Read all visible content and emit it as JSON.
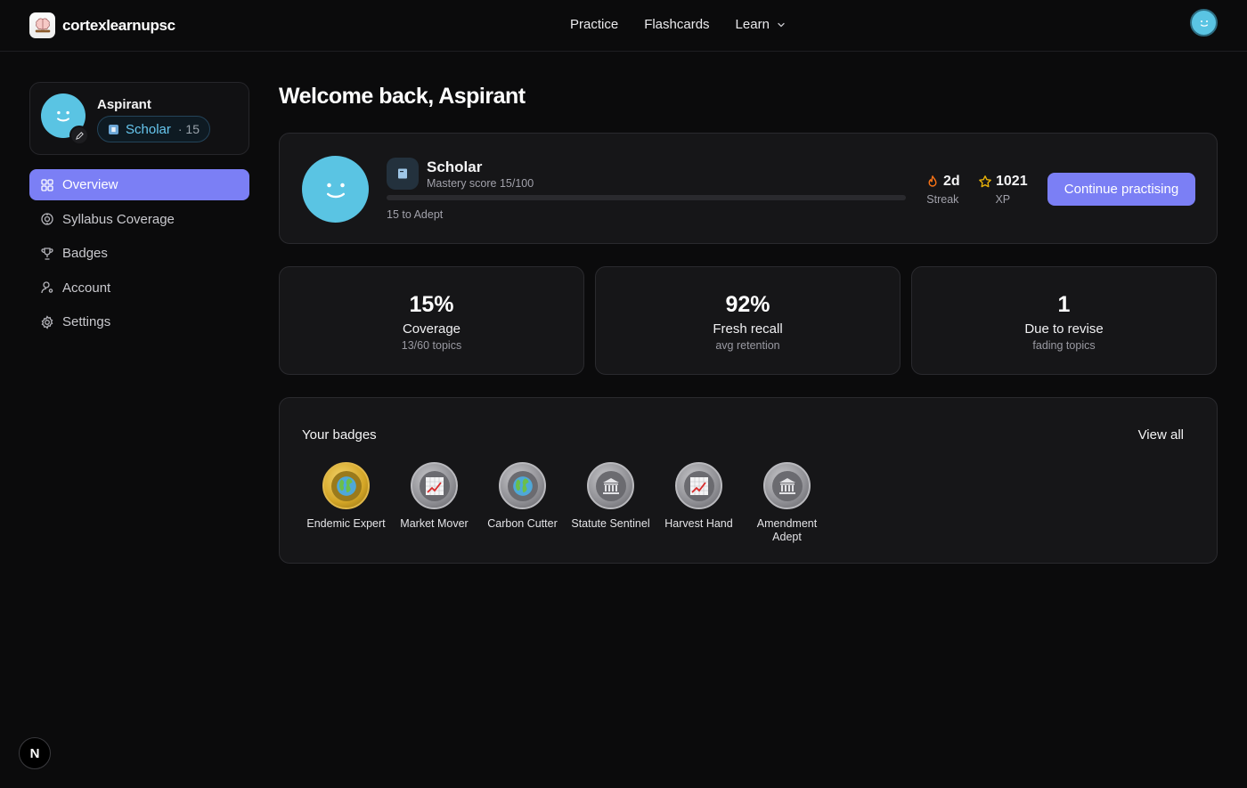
{
  "app": {
    "name": "cortexlearnupsc"
  },
  "nav": {
    "practice": "Practice",
    "flashcards": "Flashcards",
    "learn": "Learn"
  },
  "profile": {
    "name": "Aspirant",
    "rank": "Scholar",
    "score": "· 15"
  },
  "sidebar": {
    "items": [
      {
        "label": "Overview",
        "icon": "grid-icon",
        "active": true
      },
      {
        "label": "Syllabus Coverage",
        "icon": "target-icon"
      },
      {
        "label": "Badges",
        "icon": "trophy-icon"
      },
      {
        "label": "Account",
        "icon": "user-icon"
      },
      {
        "label": "Settings",
        "icon": "gear-icon"
      }
    ]
  },
  "main": {
    "welcome": "Welcome back, Aspirant",
    "hero": {
      "level": "Scholar",
      "mastery": "Mastery score 15/100",
      "mastery_fraction": 0,
      "to_next": "15 to Adept",
      "streak_value": "2d",
      "streak_label": "Streak",
      "xp_value": "1021",
      "xp_label": "XP",
      "cta": "Continue practising"
    },
    "metrics": [
      {
        "value": "15%",
        "label": "Coverage",
        "sub": "13/60 topics"
      },
      {
        "value": "92%",
        "label": "Fresh recall",
        "sub": "avg retention"
      },
      {
        "value": "1",
        "label": "Due to revise",
        "sub": "fading topics"
      }
    ],
    "badges": {
      "title": "Your badges",
      "view_all": "View all",
      "items": [
        {
          "name": "Endemic Expert",
          "icon": "globe-icon",
          "tier": "gold"
        },
        {
          "name": "Market Mover",
          "icon": "chart-icon",
          "tier": "silver"
        },
        {
          "name": "Carbon Cutter",
          "icon": "globe-icon",
          "tier": "silver"
        },
        {
          "name": "Statute Sentinel",
          "icon": "pillars-icon",
          "tier": "silver"
        },
        {
          "name": "Harvest Hand",
          "icon": "chart-icon",
          "tier": "silver"
        },
        {
          "name": "Amendment Adept",
          "icon": "pillars-icon",
          "tier": "silver"
        }
      ]
    }
  },
  "colors": {
    "accent": "#7b7ff5",
    "background": "#0b0b0c",
    "card": "#161618",
    "avatar": "#5ac4e3",
    "rank_text": "#67c7ef",
    "streak": "#f97316",
    "xp_star": "#eab308",
    "gold_medal": "#d3a526"
  },
  "misc": {
    "next_badge": "N"
  }
}
